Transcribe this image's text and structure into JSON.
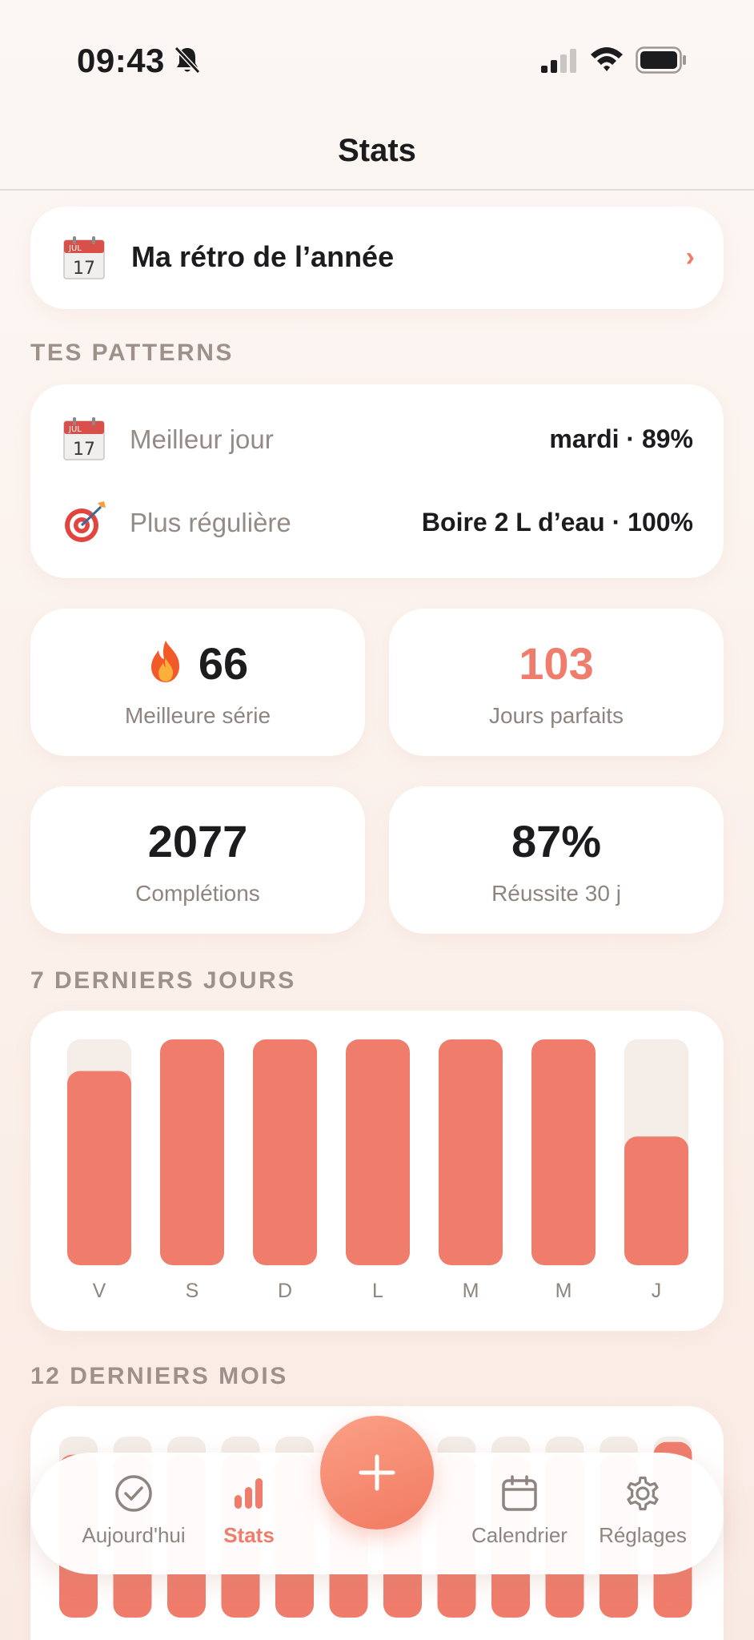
{
  "status_bar": {
    "time": "09:43"
  },
  "nav": {
    "title": "Stats"
  },
  "retro": {
    "label": "Ma rétro de l’année",
    "icon": "calendar-icon",
    "calendar_month": "JUL",
    "calendar_day": "17"
  },
  "patterns": {
    "section_label": "TES PATTERNS",
    "best_day": {
      "label": "Meilleur jour",
      "value": "mardi · 89%"
    },
    "most_regular": {
      "label": "Plus régulière",
      "value": "Boire 2 L d’eau · 100%"
    }
  },
  "tiles": {
    "best_streak": {
      "value": "66",
      "label": "Meilleure série",
      "icon": "fire-icon"
    },
    "perfect_days": {
      "value": "103",
      "label": "Jours parfaits"
    },
    "completions": {
      "value": "2077",
      "label": "Complétions"
    },
    "success_30": {
      "value": "87%",
      "label": "Réussite 30 j"
    }
  },
  "weekly": {
    "section_label": "7 DERNIERS JOURS",
    "chart_data": {
      "type": "bar",
      "categories": [
        "V",
        "S",
        "D",
        "L",
        "M",
        "M",
        "J"
      ],
      "values": [
        0.86,
        1.0,
        1.0,
        1.0,
        1.0,
        1.0,
        0.57
      ],
      "ylim": [
        0,
        1
      ]
    }
  },
  "monthly": {
    "section_label": "12 DERNIERS MOIS",
    "chart_data": {
      "type": "bar",
      "categories": [
        "",
        "",
        "",
        "",
        "",
        "",
        "",
        "",
        "",
        "",
        "",
        ""
      ],
      "values": [
        0.9,
        0.9,
        0.9,
        0.9,
        0.9,
        0.9,
        0.9,
        0.9,
        0.9,
        0.9,
        0.9,
        0.97
      ],
      "ylim": [
        0,
        1
      ]
    }
  },
  "tabbar": {
    "today": "Aujourd'hui",
    "stats": "Stats",
    "calendar": "Calendrier",
    "settings": "Réglages"
  },
  "colors": {
    "accent": "#f07c6c",
    "track": "#f4ede8",
    "background": "#fcf7f4"
  }
}
